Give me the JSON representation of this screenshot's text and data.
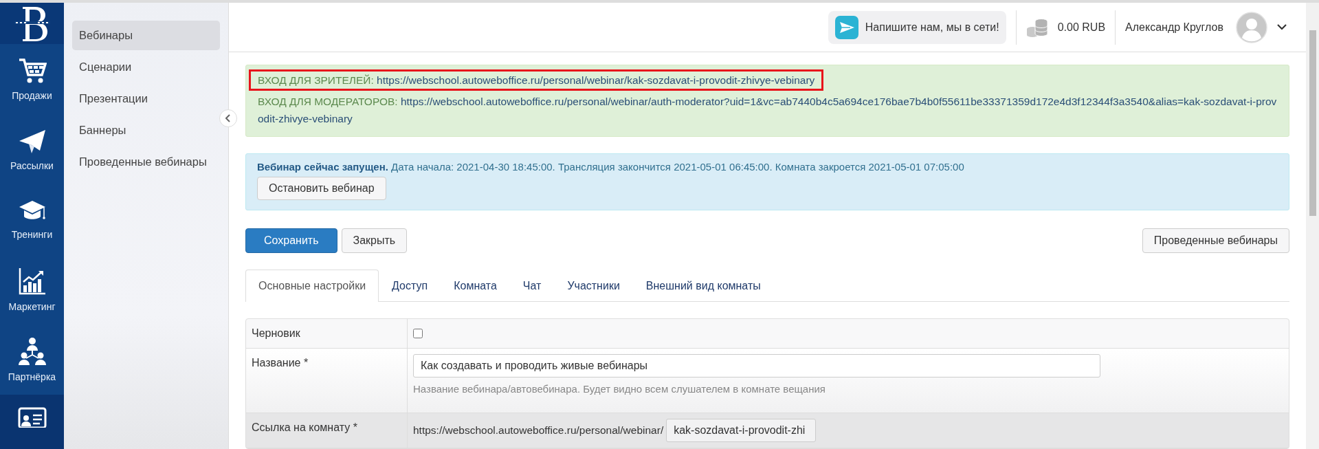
{
  "rail": {
    "items": [
      {
        "label": "Продажи",
        "kind": "cart",
        "selected": false
      },
      {
        "label": "Рассылки",
        "kind": "plane",
        "selected": false
      },
      {
        "label": "Тренинги",
        "kind": "cap",
        "selected": false
      },
      {
        "label": "Маркетинг",
        "kind": "chart",
        "selected": false
      },
      {
        "label": "Партнёрка",
        "kind": "people",
        "selected": false
      },
      {
        "kind": "card",
        "selected": true
      }
    ]
  },
  "sidebar": {
    "items": [
      {
        "label": "Вебинары",
        "selected": true
      },
      {
        "label": "Сценарии",
        "selected": false
      },
      {
        "label": "Презентации",
        "selected": false
      },
      {
        "label": "Баннеры",
        "selected": false
      },
      {
        "label": "Проведенные вебинары",
        "selected": false
      }
    ]
  },
  "topbar": {
    "chat": "Напишите нам, мы в сети!",
    "balance": "0.00 RUB",
    "user": "Александр Круглов"
  },
  "links_alert": {
    "lines": [
      {
        "label": "ВХОД ДЛЯ ЗРИТЕЛЕЙ:",
        "url": "https://webschool.autoweboffice.ru/personal/webinar/kak-sozdavat-i-provodit-zhivye-vebinary",
        "highlighted": true
      },
      {
        "label": "ВХОД ДЛЯ МОДЕРАТОРОВ:",
        "url": "https://webschool.autoweboffice.ru/personal/webinar/auth-moderator?uid=1&vc=ab7440b4c5a694ce176bae7b4b0f55611be33371359d172e4d3f12344f3a3540&alias=kak-sozdavat-i-provodit-zhivye-vebinary",
        "highlighted": false
      }
    ]
  },
  "status_alert": {
    "text": "**Вебинар сейчас запущен.** Дата начала: 2021-04-30 18:45:00. Трансляция закончится 2021-05-01 06:45:00. Комната закроется 2021-05-01 07:05:00",
    "button": "Остановить вебинар"
  },
  "actions": {
    "save": "Сохранить",
    "close": "Закрыть",
    "history": "Проведенные вебинары"
  },
  "tabs": [
    {
      "label": "Основные настройки",
      "selected": true
    },
    {
      "label": "Доступ",
      "selected": false
    },
    {
      "label": "Комната",
      "selected": false
    },
    {
      "label": "Чат",
      "selected": false
    },
    {
      "label": "Участники",
      "selected": false
    },
    {
      "label": "Внешний вид комнаты",
      "selected": false
    }
  ],
  "form": {
    "rows": [
      {
        "kind": "checkbox",
        "label": "Черновик",
        "checked": false
      },
      {
        "kind": "text",
        "label": "Название *",
        "value": "Как создавать и проводить живые вебинары",
        "help": "Название вебинара/автовебинара. Будет видно всем слушателем в комнате вещания"
      },
      {
        "kind": "prefixed",
        "label": "Ссылка на комнату *",
        "prefix": "https://webschool.autoweboffice.ru/personal/webinar/",
        "value": "kak-sozdavat-i-provodit-zhi"
      }
    ]
  }
}
